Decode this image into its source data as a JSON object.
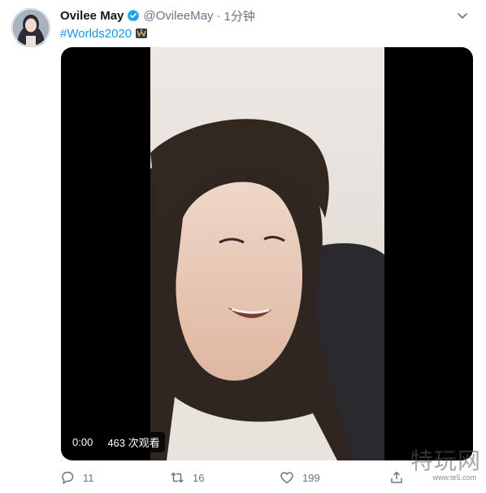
{
  "tweet": {
    "display_name": "Ovilee May",
    "handle": "@OvileeMay",
    "separator": "·",
    "timestamp": "1分钟",
    "hashtag": "#Worlds2020",
    "icons": {
      "verified": "verified-badge-icon",
      "hashtag_emoji": "worlds-emblem-icon",
      "menu": "chevron-down-icon"
    },
    "colors": {
      "hashtag": "#1b95e0",
      "verified": "#1da1f2",
      "muted": "#657786"
    }
  },
  "media": {
    "type": "video",
    "elapsed": "0:00",
    "views": "463 次观看"
  },
  "actions": {
    "reply_count": "11",
    "retweet_count": "16",
    "like_count": "199"
  },
  "watermark": {
    "main": "特玩网",
    "sub": "www.te5.com"
  }
}
